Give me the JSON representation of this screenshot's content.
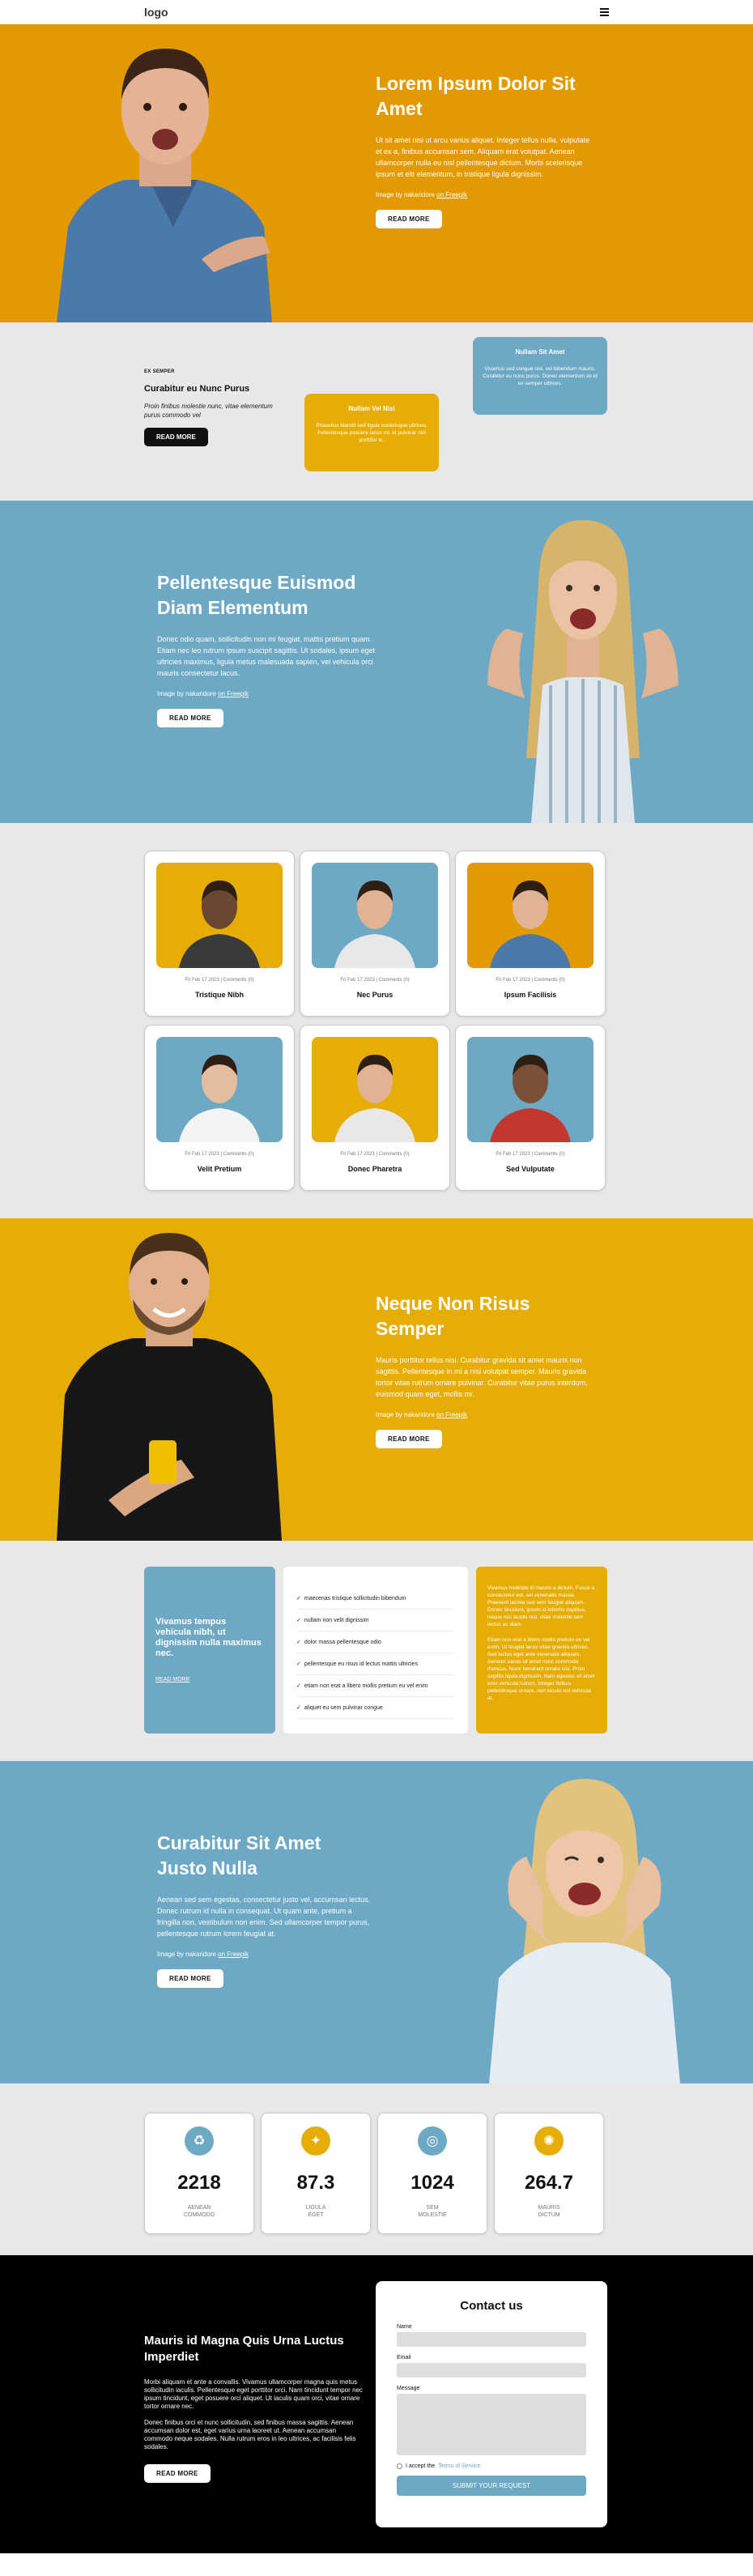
{
  "header": {
    "logo": "logo"
  },
  "hero1": {
    "title": "Lorem Ipsum Dolor Sit Amet",
    "text": "Ut sit amet nisi ut arcu varius aliquet. Integer tellus nulla, vulputate et ex a, finibus accumsan sem. Aliquam erat volutpat. Aenean ullamcorper nulla eu nisl pellentesque dictum. Morbi scelerisque ipsum et elit elementum, in tristique ligula dignissim.",
    "credit_prefix": "Image by nakaridore ",
    "credit_link": "on Freepik",
    "button": "READ MORE"
  },
  "section2": {
    "tag": "EX SEMPER",
    "title": "Curabitur eu Nunc Purus",
    "text": "Proin finibus molestie nunc, vitae elementum purus commodo vel",
    "button": "READ MORE",
    "card_yellow": {
      "title": "Nullam Vel Nisl",
      "text": "Phasellus blandit sed ligula scelerisque ultrices. Pellentesque posuere lacus mi, et pulvinar nisl porttitor in."
    },
    "card_blue": {
      "title": "Nullam Sit Amet",
      "text": "Vivamus sed congue nisi, vel bibendum mauris. Curabitur eu nunc purus. Donec elementum ex id ex semper ultrices."
    }
  },
  "hero2": {
    "title": "Pellentesque Euismod Diam Elementum",
    "text": "Donec odio quam, sollicitudin non mi feugiat, mattis pretium quam. Etiam nec leo rutrum ipsum suscipit sagittis. Ut sodales, ipsum eget ultricies maximus, ligula metus malesuada sapien, vel vehicula orci mauris consectetur lacus.",
    "credit_prefix": "Image by nakaridore ",
    "credit_link": "on Freepik",
    "button": "READ MORE"
  },
  "grid": {
    "meta": "Fri Feb 17 2023 | Comments (0)",
    "items": [
      {
        "title": "Tristique Nibh",
        "bg": "#e5ad06"
      },
      {
        "title": "Nec Purus",
        "bg": "#6da9c5"
      },
      {
        "title": "Ipsum Facilisis",
        "bg": "#e39a02"
      },
      {
        "title": "Velit Pretium",
        "bg": "#6da9c5"
      },
      {
        "title": "Donec Pharetra",
        "bg": "#e5ad06"
      },
      {
        "title": "Sed Vulputate",
        "bg": "#6da9c5"
      }
    ]
  },
  "hero3": {
    "title": "Neque Non Risus Semper",
    "text": "Mauris porttitor tellus nisi. Curabitur gravida sit amet mauris non sagittis. Pellentesque in mi a nisi volutpat semper. Mauris gravida tortor vitae rutrum ornare pulvinar. Curabitur vitae purus interdum, euismod quam eget, mollis mi.",
    "credit_prefix": "Image by nakaridore ",
    "credit_link": "on Freepik",
    "button": "READ MORE"
  },
  "lists": {
    "blue_title": "Vivamus tempus vehicula nibh, ut dignissim nulla maximus nec.",
    "blue_link": "READ MORE",
    "items": [
      "maecenas tristique sollicitudin bibendum",
      "nullam non velit dignissim",
      "dolor massa pellentesque odio",
      "pellentesque eu risus id lectus mattis ultricies",
      "etiam non erat a libero mollis pretium eu vel enim",
      "aliquet eu sem pulvinar congue"
    ],
    "check": "✓",
    "gold_p1": "Vivamus molestie id mauris a dictum. Fusce a consectetur est, vel venenatis massa. Praesent lacinia sed sem feugiat aliquam. Donec tincidunt, ipsum id lobortis dapibus, neque nisi iaculis nisi, vitae molestie sem lectus ac diam.",
    "gold_p2": "Etiam non erat a libero mollis pretium eu vel enim. Ut feugiat lacus vitae gravida ultrices. Sed luctus eget ante venenatis aliquam. Aenean varius sit amet nunc commodo rhoncus. Nunc hendrerit ornare nisi. Proin sagittis ligula dignissim. Nam egestas sit amet eros vehicula rutrum. Integer finibus pellentesque ornare, non iaculis est vehicula at."
  },
  "hero4": {
    "title": "Curabitur Sit Amet Justo Nulla",
    "text": "Aenean sed sem egestas, consectetur justo vel, accumsan lectus. Donec rutrum id nulla in consequat. Ut quam ante, pretium a fringilla non, vestibulum non enim. Sed ullamcorper tempor purus, pellentesque rutrum lorem feugiat at.",
    "credit_prefix": "Image by nakaridore ",
    "credit_link": "on Freepik",
    "button": "READ MORE"
  },
  "stats": [
    {
      "value": "2218",
      "label1": "AENEAN",
      "label2": "COMMODO",
      "color": "#6da9c5",
      "icon": "recycle-icon",
      "glyph": "♻"
    },
    {
      "value": "87.3",
      "label1": "LIGULA",
      "label2": "EGET",
      "color": "#e5ad06",
      "icon": "lightbulb-icon",
      "glyph": "✦"
    },
    {
      "value": "1024",
      "label1": "SEM",
      "label2": "MOLESTIE",
      "color": "#6da9c5",
      "icon": "target-icon",
      "glyph": "◎"
    },
    {
      "value": "264.7",
      "label1": "MAURIS",
      "label2": "DICTUM",
      "color": "#e5ad06",
      "icon": "sun-icon",
      "glyph": "✺"
    }
  ],
  "contact": {
    "title": "Mauris id Magna Quis Urna Luctus Imperdiet",
    "p1": "Morbi aliquam et ante a convallis. Vivamus ullamcorper magna quis metus sollicitudin iaculis. Pellentesque eget porttitor orci. Nam tincidunt tempor nec ipsum tincidunt, eget posuere orci aliquet. Ut iaculis quam orci, vitae ornare tortor ornare nec.",
    "p2": "Donec finibus orci et nunc sollicitudin, sed finibus massa sagittis. Aenean accumsan dolor est, eget varius urna laoreet ut. Aenean accumsan commodo neque sodales. Nulla rutrum eros in leo ultrices, ac facilisis felis sodales.",
    "button": "READ MORE",
    "form_title": "Contact us",
    "name_label": "Name",
    "email_label": "Email",
    "message_label": "Message",
    "terms_prefix": "I accept the ",
    "terms_link": "Terms of Service",
    "submit": "SUBMIT YOUR REQUEST"
  }
}
